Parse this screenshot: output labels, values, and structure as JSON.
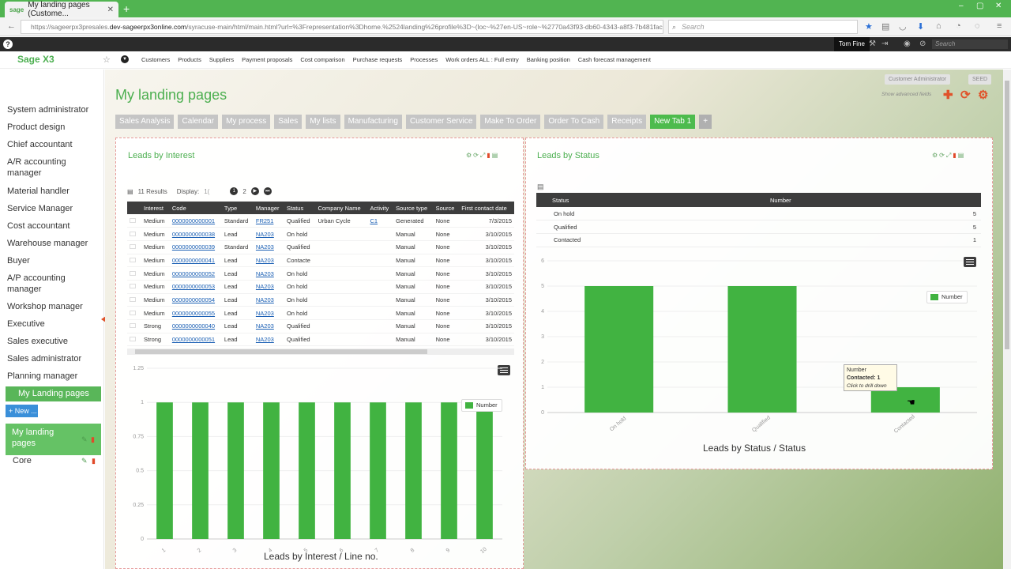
{
  "browser": {
    "tab_title": "My landing pages (Custome...",
    "favicon_text": "sage",
    "url_prefix": "https://sageerpx3presales.",
    "url_domain": "dev-sageerpx3online.com",
    "url_rest": "/syracuse-main/html/main.html?url=%3Frepresentation%3Dhome.%2524landing%26profile%3D~(loc~%27en-US~role~%2770a43f93-db60-4343-a8f3-7b481fac6bf7~ep~",
    "search_placeholder": "Search"
  },
  "sage": {
    "user": "Tom Fine",
    "search_placeholder": "Search",
    "logo": "Sage X3",
    "nav_links": [
      "Customers",
      "Products",
      "Suppliers",
      "Payment proposals",
      "Cost comparison",
      "Purchase requests",
      "Processes",
      "Work orders ALL : Full entry",
      "Banking position",
      "Cash forecast management"
    ]
  },
  "sidebar": {
    "items": [
      "System administrator",
      "Product design",
      "Chief accountant",
      "A/R accounting manager",
      "Material handler",
      "Service Manager",
      "Cost accountant",
      "Warehouse manager",
      "Buyer",
      "A/P accounting manager",
      "Workshop manager",
      "Executive",
      "Sales executive",
      "Sales administrator",
      "Planning manager"
    ],
    "active": "My Landing pages",
    "new_button": "+ New ...",
    "sub_item": "My landing pages",
    "core": "Core"
  },
  "page": {
    "title": "My landing pages",
    "role_chip": "Customer Administrator",
    "seed_chip": "SEED",
    "advanced_fields": "Show advanced fields",
    "tabs": [
      "Sales Analysis",
      "Calendar",
      "My process",
      "Sales",
      "My lists",
      "Manufacturing",
      "Customer Service",
      "Make To Order",
      "Order To Cash",
      "Receipts",
      "New Tab 1",
      "+"
    ]
  },
  "leads_interest": {
    "title": "Leads by Interest",
    "results": "11 Results",
    "display_label": "Display:",
    "display_value": "1(",
    "pages": [
      "1",
      "2"
    ],
    "columns": [
      "Interest",
      "Code",
      "Type",
      "Manager",
      "Status",
      "Company Name",
      "Activity",
      "Source type",
      "Source",
      "First contact date"
    ],
    "rows": [
      [
        "Medium",
        "0000000000001",
        "Standard",
        "FR251",
        "Qualified",
        "Urban Cycle",
        "C1",
        "Generated",
        "None",
        "7/3/2015"
      ],
      [
        "Medium",
        "0000000000038",
        "Lead",
        "NA203",
        "On hold",
        "",
        "",
        "Manual",
        "None",
        "3/10/2015"
      ],
      [
        "Medium",
        "0000000000039",
        "Standard",
        "NA203",
        "Qualified",
        "",
        "",
        "Manual",
        "None",
        "3/10/2015"
      ],
      [
        "Medium",
        "0000000000041",
        "Lead",
        "NA203",
        "Contacte",
        "",
        "",
        "Manual",
        "None",
        "3/10/2015"
      ],
      [
        "Medium",
        "0000000000052",
        "Lead",
        "NA203",
        "On hold",
        "",
        "",
        "Manual",
        "None",
        "3/10/2015"
      ],
      [
        "Medium",
        "0000000000053",
        "Lead",
        "NA203",
        "On hold",
        "",
        "",
        "Manual",
        "None",
        "3/10/2015"
      ],
      [
        "Medium",
        "0000000000054",
        "Lead",
        "NA203",
        "On hold",
        "",
        "",
        "Manual",
        "None",
        "3/10/2015"
      ],
      [
        "Medium",
        "0000000000055",
        "Lead",
        "NA203",
        "On hold",
        "",
        "",
        "Manual",
        "None",
        "3/10/2015"
      ],
      [
        "Strong",
        "0000000000040",
        "Lead",
        "NA203",
        "Qualified",
        "",
        "",
        "Manual",
        "None",
        "3/10/2015"
      ],
      [
        "Strong",
        "0000000000051",
        "Lead",
        "NA203",
        "Qualified",
        "",
        "",
        "Manual",
        "None",
        "3/10/2015"
      ]
    ],
    "chart_caption": "Leads by Interest / Line no."
  },
  "leads_status": {
    "title": "Leads by Status",
    "columns": [
      "Status",
      "Number"
    ],
    "rows": [
      [
        "On hold",
        "5"
      ],
      [
        "Qualified",
        "5"
      ],
      [
        "Contacted",
        "1"
      ]
    ],
    "chart_caption": "Leads by Status / Status",
    "tooltip_title": "Number",
    "tooltip_value": "Contacted: 1",
    "tooltip_hint": "Click to drill down"
  },
  "chart_data": [
    {
      "type": "bar",
      "categories": [
        "1",
        "2",
        "3",
        "4",
        "5",
        "6",
        "7",
        "8",
        "9",
        "10"
      ],
      "series": [
        {
          "name": "Number",
          "values": [
            1,
            1,
            1,
            1,
            1,
            1,
            1,
            1,
            1,
            1
          ]
        }
      ],
      "title": "Leads by Interest / Line no.",
      "ylim": [
        0,
        1.25
      ],
      "yticks": [
        "0",
        "0.25",
        "0.5",
        "0.75",
        "1",
        "1.25"
      ],
      "legend": "top-right",
      "color": "#41b341"
    },
    {
      "type": "bar",
      "categories": [
        "On hold",
        "Qualified",
        "Contacted"
      ],
      "series": [
        {
          "name": "Number",
          "values": [
            5,
            5,
            1
          ]
        }
      ],
      "title": "Leads by Status / Status",
      "ylim": [
        0,
        6
      ],
      "yticks": [
        "0",
        "1",
        "2",
        "3",
        "4",
        "5",
        "6"
      ],
      "legend": "top-right",
      "color": "#41b341"
    }
  ]
}
